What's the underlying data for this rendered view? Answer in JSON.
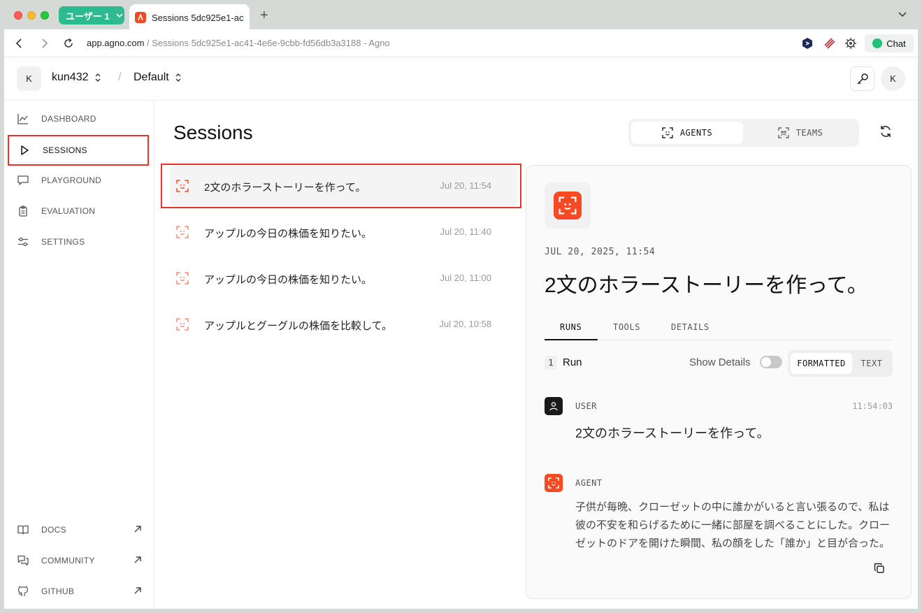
{
  "browser": {
    "profile_label": "ユーザー 1",
    "tab_title": "Sessions 5dc925e1-ac41-4e6e-9cbb-fd56db3a3188 - Agno",
    "url_host": "app.agno.com",
    "url_path": " / Sessions 5dc925e1-ac41-4e6e-9cbb-fd56db3a3188 - Agno",
    "chat_label": "Chat"
  },
  "topbar": {
    "workspace_initial": "K",
    "workspace_name": "kun432",
    "separator": "/",
    "project_name": "Default",
    "user_initial": "K"
  },
  "sidebar": {
    "items": [
      {
        "label": "DASHBOARD",
        "icon": "chart-line-icon"
      },
      {
        "label": "SESSIONS",
        "icon": "play-icon"
      },
      {
        "label": "PLAYGROUND",
        "icon": "chat-bubble-icon"
      },
      {
        "label": "EVALUATION",
        "icon": "clipboard-icon"
      },
      {
        "label": "SETTINGS",
        "icon": "sliders-icon"
      }
    ],
    "bottom_items": [
      {
        "label": "DOCS",
        "icon": "book-icon"
      },
      {
        "label": "COMMUNITY",
        "icon": "chat-bubbles-icon"
      },
      {
        "label": "GITHUB",
        "icon": "github-icon"
      }
    ]
  },
  "main": {
    "title": "Sessions",
    "segments": [
      {
        "label": "AGENTS",
        "selected": true
      },
      {
        "label": "TEAMS",
        "selected": false
      }
    ]
  },
  "sessions": [
    {
      "title": "2文のホラーストーリーを作って。",
      "time": "Jul 20, 11:54",
      "selected": true
    },
    {
      "title": "アップルの今日の株価を知りたい。",
      "time": "Jul 20, 11:40",
      "selected": false
    },
    {
      "title": "アップルの今日の株価を知りたい。",
      "time": "Jul 20, 11:00",
      "selected": false
    },
    {
      "title": "アップルとグーグルの株価を比較して。",
      "time": "Jul 20, 10:58",
      "selected": false
    }
  ],
  "detail": {
    "date": "JUL 20, 2025, 11:54",
    "title": "2文のホラーストーリーを作って。",
    "tabs": [
      "RUNS",
      "TOOLS",
      "DETAILS"
    ],
    "run_count": "1",
    "run_label": "Run",
    "show_details_label": "Show Details",
    "show_details_on": false,
    "format_options": [
      "FORMATTED",
      "TEXT"
    ],
    "messages": {
      "user": {
        "role": "USER",
        "time": "11:54:03",
        "text": "2文のホラーストーリーを作って。"
      },
      "agent": {
        "role": "AGENT",
        "lines": [
          "子供が毎晩、クローゼットの中に誰かがいると言い張るので、私は",
          "彼の不安を和らげるために一緒に部屋を調べることにした。クロー",
          "ゼットのドアを開けた瞬間、私の顔をした「誰か」と目が合った。"
        ]
      }
    }
  },
  "colors": {
    "accent": "#f54a23",
    "highlight": "#e8322c",
    "profile": "#2fb98f"
  }
}
